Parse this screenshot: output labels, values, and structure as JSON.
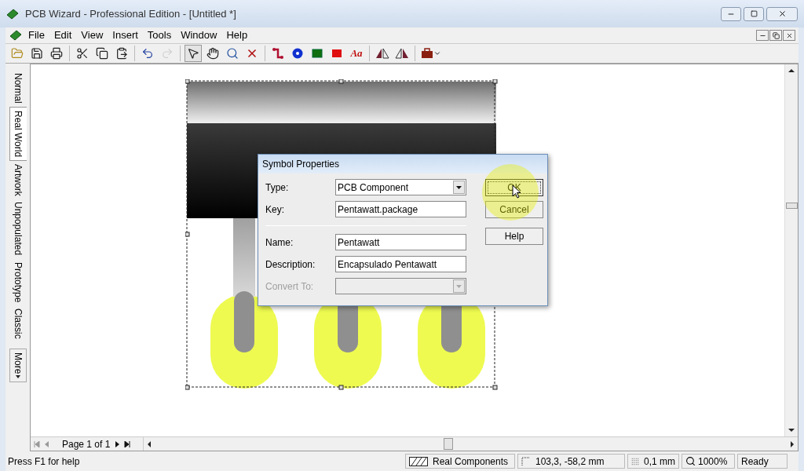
{
  "window": {
    "title": "PCB Wizard - Professional Edition - [Untitled *]"
  },
  "menu": [
    "File",
    "Edit",
    "View",
    "Insert",
    "Tools",
    "Window",
    "Help"
  ],
  "toolbar": [
    {
      "kind": "open",
      "disabled": false
    },
    {
      "kind": "save",
      "disabled": false
    },
    {
      "kind": "print",
      "disabled": false
    },
    {
      "kind": "separator"
    },
    {
      "kind": "cut",
      "disabled": false
    },
    {
      "kind": "copy",
      "disabled": false
    },
    {
      "kind": "paste",
      "disabled": false
    },
    {
      "kind": "separator"
    },
    {
      "kind": "undo",
      "disabled": false
    },
    {
      "kind": "redo",
      "disabled": true
    },
    {
      "kind": "separator"
    },
    {
      "kind": "select",
      "disabled": false
    },
    {
      "kind": "pan",
      "disabled": false
    },
    {
      "kind": "zoom",
      "disabled": false
    },
    {
      "kind": "delete",
      "disabled": false
    },
    {
      "kind": "separator"
    },
    {
      "kind": "track",
      "disabled": false
    },
    {
      "kind": "pad",
      "disabled": false
    },
    {
      "kind": "component",
      "disabled": false
    },
    {
      "kind": "copper",
      "disabled": false
    },
    {
      "kind": "text",
      "disabled": false,
      "label": "Aa"
    },
    {
      "kind": "separator"
    },
    {
      "kind": "flip-left",
      "disabled": false
    },
    {
      "kind": "flip-right",
      "disabled": false
    },
    {
      "kind": "separator"
    },
    {
      "kind": "library",
      "disabled": false
    }
  ],
  "view_tabs": [
    {
      "label": "Normal",
      "selected": false
    },
    {
      "label": "Real World",
      "selected": true
    },
    {
      "label": "Artwork",
      "selected": false
    },
    {
      "label": "Unpopulated",
      "selected": false
    },
    {
      "label": "Prototype",
      "selected": false
    },
    {
      "label": "Classic",
      "selected": false
    }
  ],
  "more_tab": {
    "label": "More"
  },
  "dialog": {
    "title": "Symbol Properties",
    "fields": [
      {
        "label": "Type:",
        "kind": "dropdown",
        "value": "PCB Component",
        "disabled": false
      },
      {
        "label": "Key:",
        "kind": "text",
        "value": "Pentawatt.package",
        "disabled": false
      },
      {
        "kind": "separator"
      },
      {
        "label": "Name:",
        "kind": "text",
        "value": "Pentawatt",
        "disabled": false
      },
      {
        "label": "Description:",
        "kind": "text",
        "value": "Encapsulado Pentawatt",
        "disabled": false
      },
      {
        "label": "Convert To:",
        "kind": "dropdown",
        "disabled": true
      }
    ],
    "buttons": [
      {
        "label": "OK",
        "default": true
      },
      {
        "label": "Cancel",
        "default": false
      },
      {
        "label": "Help",
        "default": false
      }
    ]
  },
  "page_nav": {
    "label": "Page 1 of 1"
  },
  "status_bar": {
    "help": "Press F1 for help",
    "layer": "Real Components",
    "coords": "103,3, -58,2 mm",
    "grid": "0,1 mm",
    "zoom": "1000%",
    "state": "Ready"
  }
}
